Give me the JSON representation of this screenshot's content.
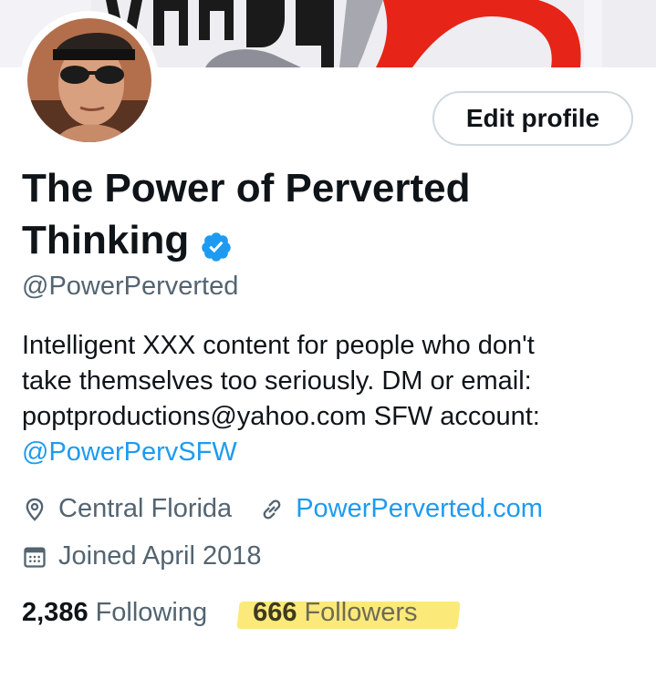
{
  "profile": {
    "name_line1": "The Power of Perverted",
    "name_line2": "Thinking",
    "handle": "@PowerPerverted",
    "edit_button_label": "Edit profile",
    "bio": {
      "line1": "Intelligent XXX content for people who don't",
      "line2": "take themselves too seriously.  DM or email:",
      "line3": "poptproductions@yahoo.com SFW account:",
      "mention": "@PowerPervSFW"
    },
    "location": "Central Florida",
    "website": "PowerPerverted.com",
    "joined": "Joined April 2018",
    "following_count": "2,386",
    "following_label": "Following",
    "followers_count": "666",
    "followers_label": "Followers"
  },
  "icons": {
    "verified": "verified-badge-icon",
    "location": "location-pin-icon",
    "website": "link-icon",
    "joined": "calendar-icon"
  },
  "colors": {
    "link": "#1d9bf0",
    "text": "#0f1419",
    "secondary": "#536471",
    "highlight": "#fbe97a"
  }
}
